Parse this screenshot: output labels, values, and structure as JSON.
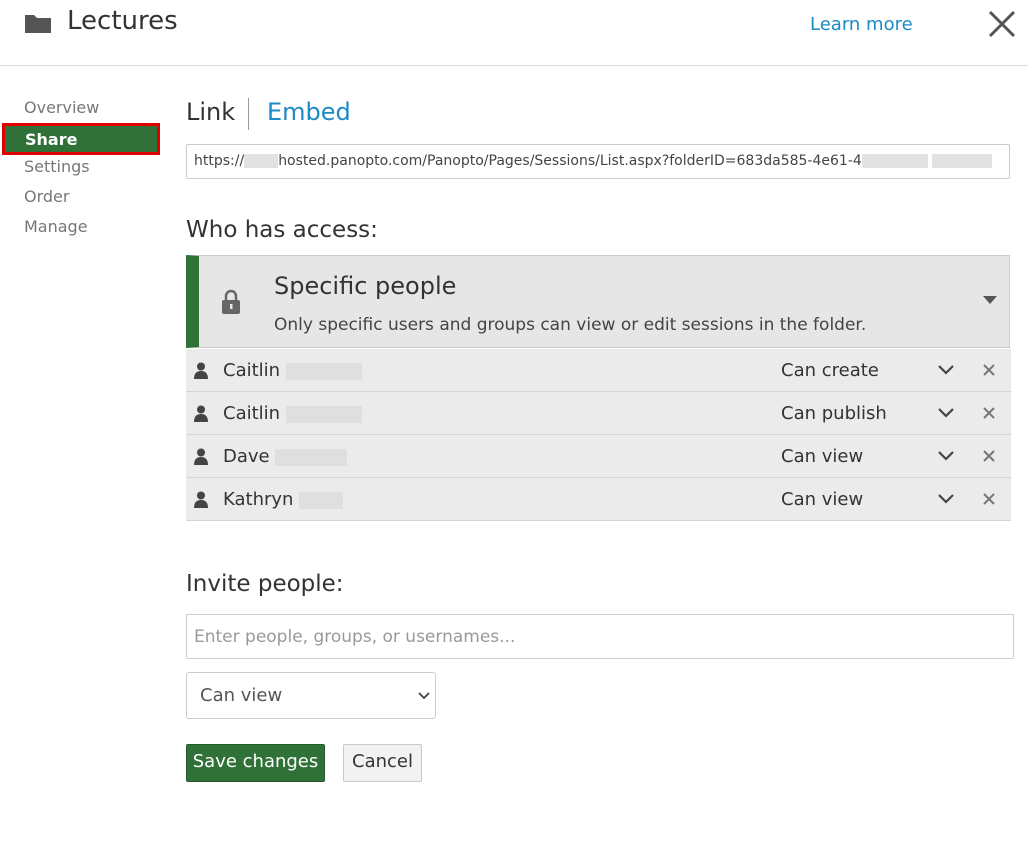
{
  "header": {
    "title": "Lectures",
    "learn_more": "Learn more",
    "folder_icon": "folder-icon",
    "close_icon": "close-icon"
  },
  "sidebar": {
    "items": [
      {
        "label": "Overview",
        "active": false
      },
      {
        "label": "Share",
        "active": true
      },
      {
        "label": "Settings",
        "active": false
      },
      {
        "label": "Order",
        "active": false
      },
      {
        "label": "Manage",
        "active": false
      }
    ]
  },
  "link_section": {
    "tabs": [
      "Link",
      "Embed"
    ],
    "url_prefix": "https://",
    "url_middle": "hosted.panopto.com/Panopto/Pages/Sessions/List.aspx?folderID=683da585-4e61-4"
  },
  "access": {
    "label": "Who has access:",
    "title": "Specific people",
    "description": "Only specific users and groups can view or edit sessions in the folder.",
    "icon": "lock-icon",
    "accent_color": "#2f7137"
  },
  "people": [
    {
      "name": "Caitlin",
      "permission": "Can create"
    },
    {
      "name": "Caitlin",
      "permission": "Can publish"
    },
    {
      "name": "Dave",
      "permission": "Can view"
    },
    {
      "name": "Kathryn",
      "permission": "Can view"
    }
  ],
  "invite": {
    "label": "Invite people:",
    "placeholder": "Enter people, groups, or usernames...",
    "permission_selected": "Can view"
  },
  "buttons": {
    "save": "Save changes",
    "cancel": "Cancel"
  },
  "colors": {
    "brand_green": "#2f7137",
    "link_blue": "#1b8ac5",
    "highlight_red": "#e00000"
  }
}
